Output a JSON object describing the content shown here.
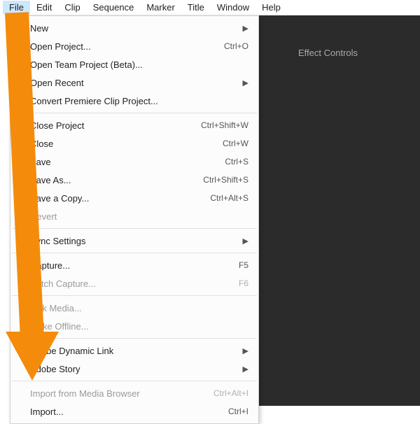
{
  "menubar": {
    "items": [
      "File",
      "Edit",
      "Clip",
      "Sequence",
      "Marker",
      "Title",
      "Window",
      "Help"
    ]
  },
  "panel": {
    "tab": "Effect Controls"
  },
  "dropdown": {
    "groups": [
      [
        {
          "label": "New",
          "shortcut": "",
          "submenu": true,
          "disabled": false
        },
        {
          "label": "Open Project...",
          "shortcut": "Ctrl+O",
          "submenu": false,
          "disabled": false
        },
        {
          "label": "Open Team Project (Beta)...",
          "shortcut": "",
          "submenu": false,
          "disabled": false
        },
        {
          "label": "Open Recent",
          "shortcut": "",
          "submenu": true,
          "disabled": false
        },
        {
          "label": "Convert Premiere Clip Project...",
          "shortcut": "",
          "submenu": false,
          "disabled": false
        }
      ],
      [
        {
          "label": "Close Project",
          "shortcut": "Ctrl+Shift+W",
          "submenu": false,
          "disabled": false
        },
        {
          "label": "Close",
          "shortcut": "Ctrl+W",
          "submenu": false,
          "disabled": false
        },
        {
          "label": "Save",
          "shortcut": "Ctrl+S",
          "submenu": false,
          "disabled": false
        },
        {
          "label": "Save As...",
          "shortcut": "Ctrl+Shift+S",
          "submenu": false,
          "disabled": false
        },
        {
          "label": "Save a Copy...",
          "shortcut": "Ctrl+Alt+S",
          "submenu": false,
          "disabled": false
        },
        {
          "label": "Revert",
          "shortcut": "",
          "submenu": false,
          "disabled": true
        }
      ],
      [
        {
          "label": "Sync Settings",
          "shortcut": "",
          "submenu": true,
          "disabled": false
        }
      ],
      [
        {
          "label": "Capture...",
          "shortcut": "F5",
          "submenu": false,
          "disabled": false
        },
        {
          "label": "Batch Capture...",
          "shortcut": "F6",
          "submenu": false,
          "disabled": true
        }
      ],
      [
        {
          "label": "Link Media...",
          "shortcut": "",
          "submenu": false,
          "disabled": true
        },
        {
          "label": "Make Offline...",
          "shortcut": "",
          "submenu": false,
          "disabled": true
        }
      ],
      [
        {
          "label": "Adobe Dynamic Link",
          "shortcut": "",
          "submenu": true,
          "disabled": false
        },
        {
          "label": "Adobe Story",
          "shortcut": "",
          "submenu": true,
          "disabled": false
        }
      ],
      [
        {
          "label": "Import from Media Browser",
          "shortcut": "Ctrl+Alt+I",
          "submenu": false,
          "disabled": true
        },
        {
          "label": "Import...",
          "shortcut": "Ctrl+I",
          "submenu": false,
          "disabled": false
        }
      ]
    ]
  },
  "annotation": {
    "arrow_color": "#f58b0a"
  }
}
